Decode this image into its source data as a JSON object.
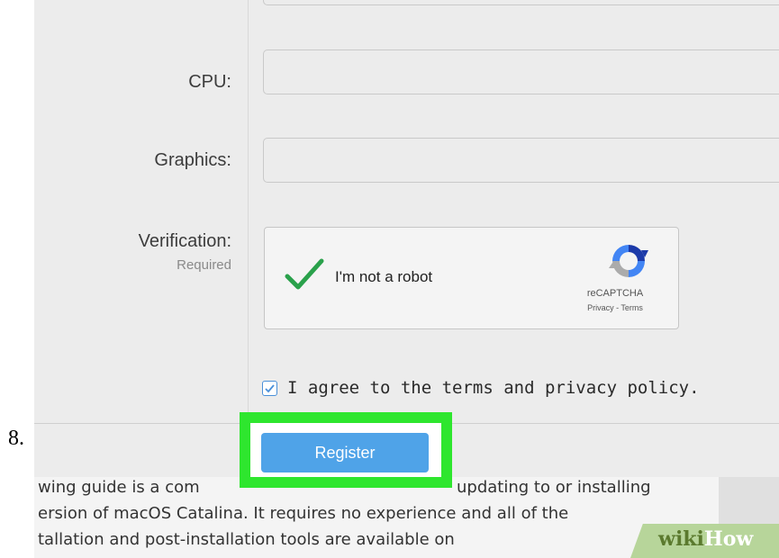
{
  "step_number": "8.",
  "form": {
    "cpu_label": "CPU:",
    "graphics_label": "Graphics:",
    "verification_label": "Verification:",
    "verification_sublabel": "Required",
    "cpu_value": "",
    "graphics_value": ""
  },
  "recaptcha": {
    "checkbox_label": "I'm not a robot",
    "checked": true,
    "brand": "reCAPTCHA",
    "links": "Privacy - Terms"
  },
  "agree": {
    "checked": true,
    "label": "I agree to the terms and privacy policy."
  },
  "register_button": {
    "label": "Register",
    "highlight_color": "#2ee62e",
    "button_color": "#4fa3e8"
  },
  "article": {
    "lines": [
      "wing guide is a com",
      "ersion of macOS Catalina. It requires no experience and all of the",
      "tallation and post-installation tools are available on"
    ],
    "line_1_tail": "updating to or installing"
  },
  "watermark": {
    "part1": "wiki",
    "part2": "How"
  }
}
